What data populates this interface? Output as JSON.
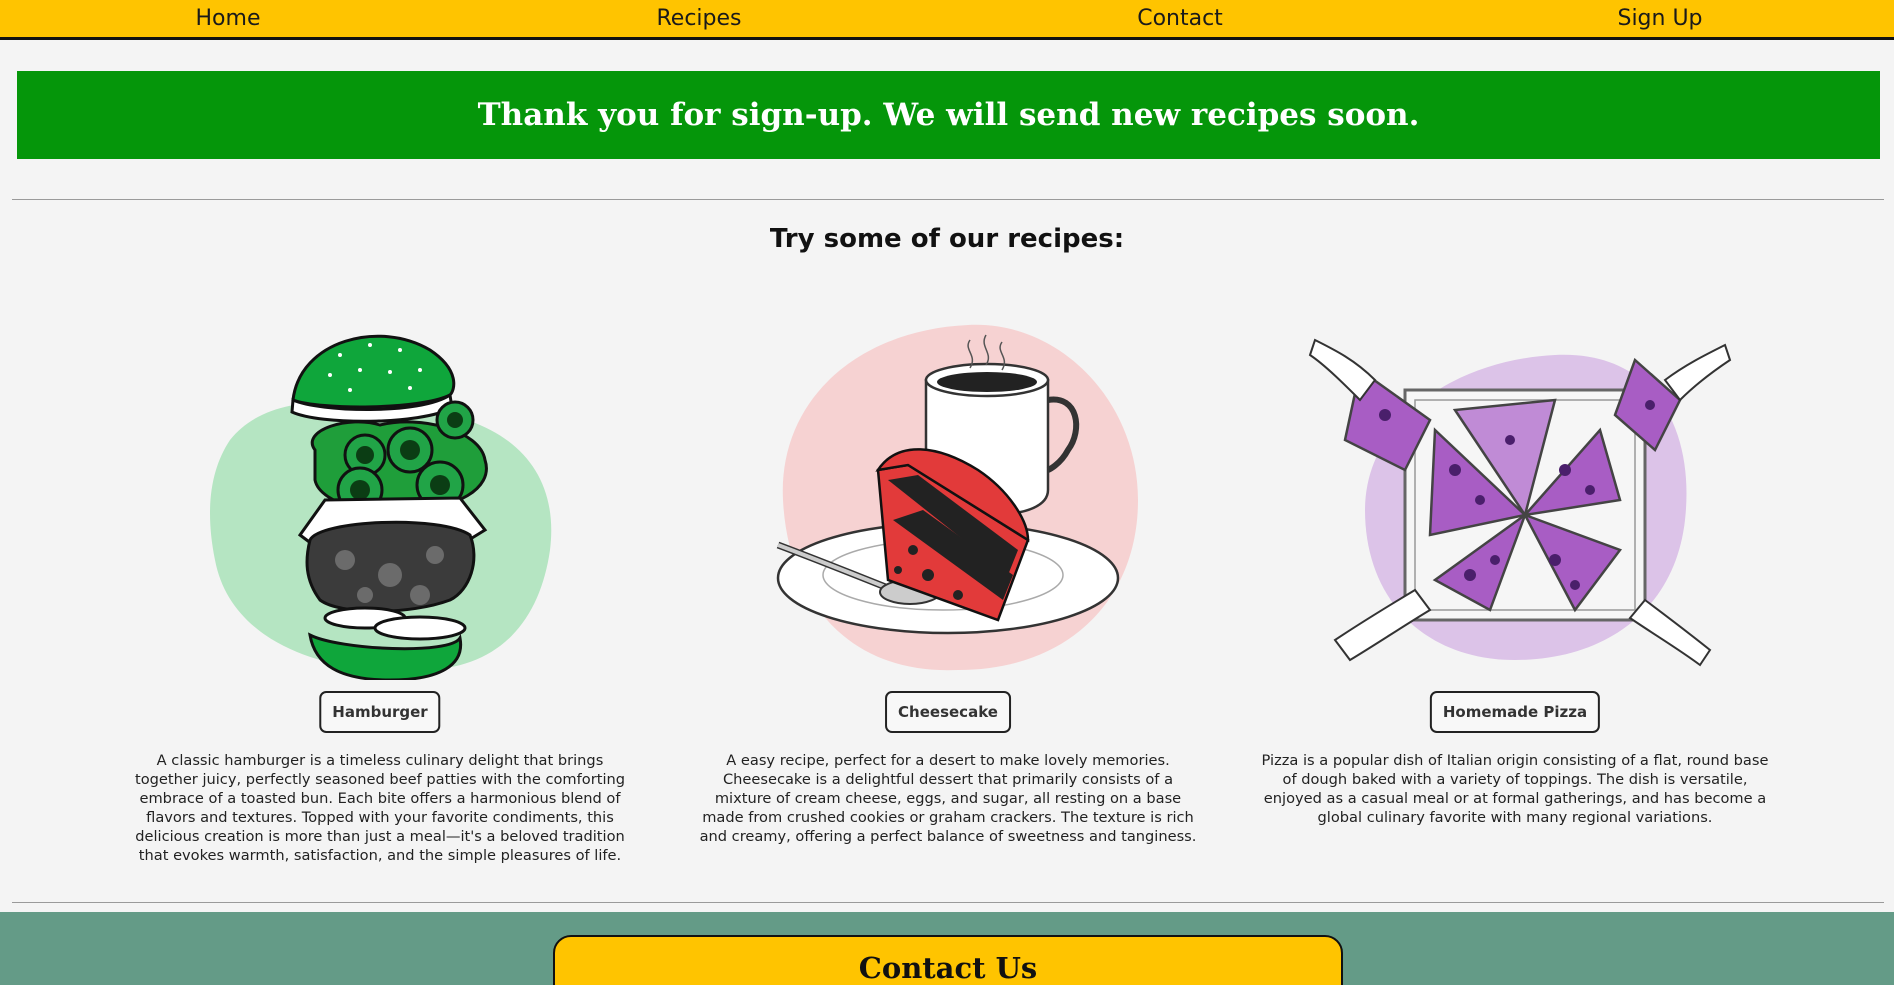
{
  "nav": {
    "items": [
      {
        "label": "Home"
      },
      {
        "label": "Recipes"
      },
      {
        "label": "Contact"
      },
      {
        "label": "Sign Up"
      }
    ]
  },
  "banner": {
    "text": "Thank you for sign-up. We will send new recipes soon.",
    "color": "#05960a"
  },
  "recipes_section": {
    "title": "Try some of our recipes:",
    "cards": [
      {
        "button_label": "Hamburger",
        "illustration": "hamburger-illustration",
        "description": "A classic hamburger is a timeless culinary delight that brings together juicy, perfectly seasoned beef patties with the comforting embrace of a toasted bun. Each bite offers a harmonious blend of flavors and textures. Topped with your favorite condiments, this delicious creation is more than just a meal—it's a beloved tradition that evokes warmth, satisfaction, and the simple pleasures of life."
      },
      {
        "button_label": "Cheesecake",
        "illustration": "cheesecake-illustration",
        "description": "A easy recipe, perfect for a desert to make lovely memories. Cheesecake is a delightful dessert that primarily consists of a mixture of cream cheese, eggs, and sugar, all resting on a base made from crushed cookies or graham crackers. The texture is rich and creamy, offering a perfect balance of sweetness and tanginess."
      },
      {
        "button_label": "Homemade Pizza",
        "illustration": "pizza-illustration",
        "description": "Pizza is a popular dish of Italian origin consisting of a flat, round base of dough baked with a variety of toppings. The dish is versatile, enjoyed as a casual meal or at formal gatherings, and has become a global culinary favorite with many regional variations."
      }
    ]
  },
  "footer": {
    "contact_title": "Contact Us"
  },
  "colors": {
    "nav_bg": "#ffc400",
    "footer_bg": "#649b87",
    "page_bg": "#f4f4f4"
  }
}
